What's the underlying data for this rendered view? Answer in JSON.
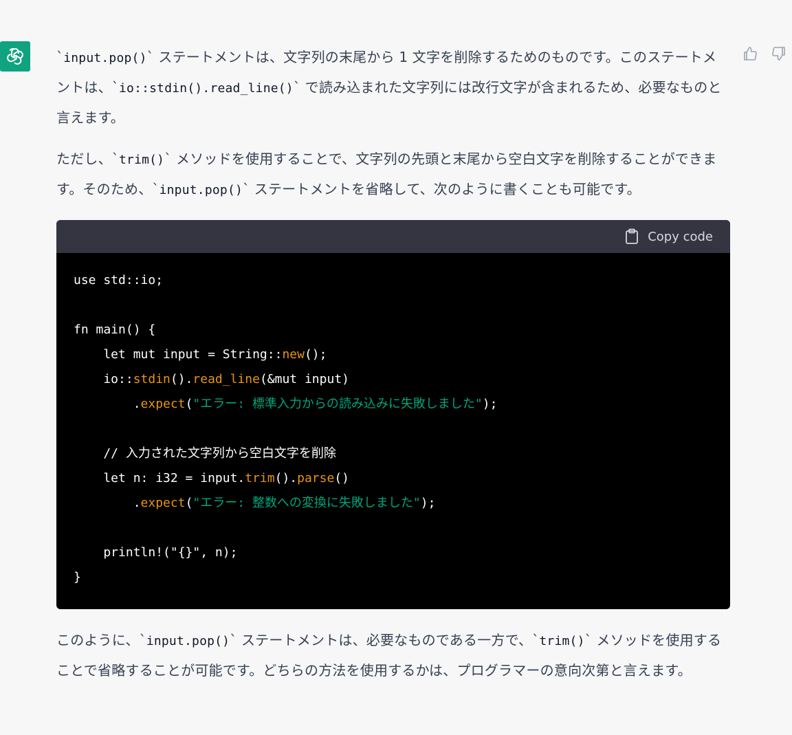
{
  "paragraphs": {
    "p1": {
      "t1": "`",
      "c1": "input.pop()",
      "t2": "` ステートメントは、文字列の末尾から 1 文字を削除するためのものです。このステートメントは、`",
      "c2": "io::stdin().read_line()",
      "t3": "` で読み込まれた文字列には改行文字が含まれるため、必要なものと言えます。"
    },
    "p2": {
      "t1": "ただし、`",
      "c1": "trim()",
      "t2": "` メソッドを使用することで、文字列の先頭と末尾から空白文字を削除することができます。そのため、`",
      "c2": "input.pop()",
      "t3": "` ステートメントを省略して、次のように書くことも可能です。"
    },
    "p3": {
      "t1": "このように、`",
      "c1": "input.pop()",
      "t2": "` ステートメントは、必要なものである一方で、`",
      "c2": "trim()",
      "t3": "` メソッドを使用することで省略することが可能です。どちらの方法を使用するかは、プログラマーの意向次第と言えます。"
    }
  },
  "code_block": {
    "copy_label": "Copy code",
    "lines": {
      "l1": "use std::io;",
      "l3": "fn main() {",
      "l4a": "    let mut input = String::",
      "l4b": "new",
      "l4c": "();",
      "l5a": "    io::",
      "l5b": "stdin",
      "l5c": "().",
      "l5d": "read_line",
      "l5e": "(&mut input)",
      "l6a": "        .",
      "l6b": "expect",
      "l6c": "(",
      "l6d": "\"エラー: 標準入力からの読み込みに失敗しました\"",
      "l6e": ");",
      "l8": "    // 入力された文字列から空白文字を削除",
      "l9a": "    let n: i32 = input.",
      "l9b": "trim",
      "l9c": "().",
      "l9d": "parse",
      "l9e": "()",
      "l10a": "        .",
      "l10b": "expect",
      "l10c": "(",
      "l10d": "\"エラー: 整数への変換に失敗しました\"",
      "l10e": ");",
      "l12": "    println!(\"{}\", n);",
      "l13": "}"
    }
  },
  "icons": {
    "avatar": "openai-logo-icon",
    "copy": "clipboard-icon",
    "like": "thumbs-up-icon",
    "dislike": "thumbs-down-icon"
  },
  "colors": {
    "avatar_bg": "#10a37f",
    "code_bg": "#000000",
    "code_header_bg": "#343541",
    "function": "#e9950c",
    "string": "#00a67d"
  }
}
